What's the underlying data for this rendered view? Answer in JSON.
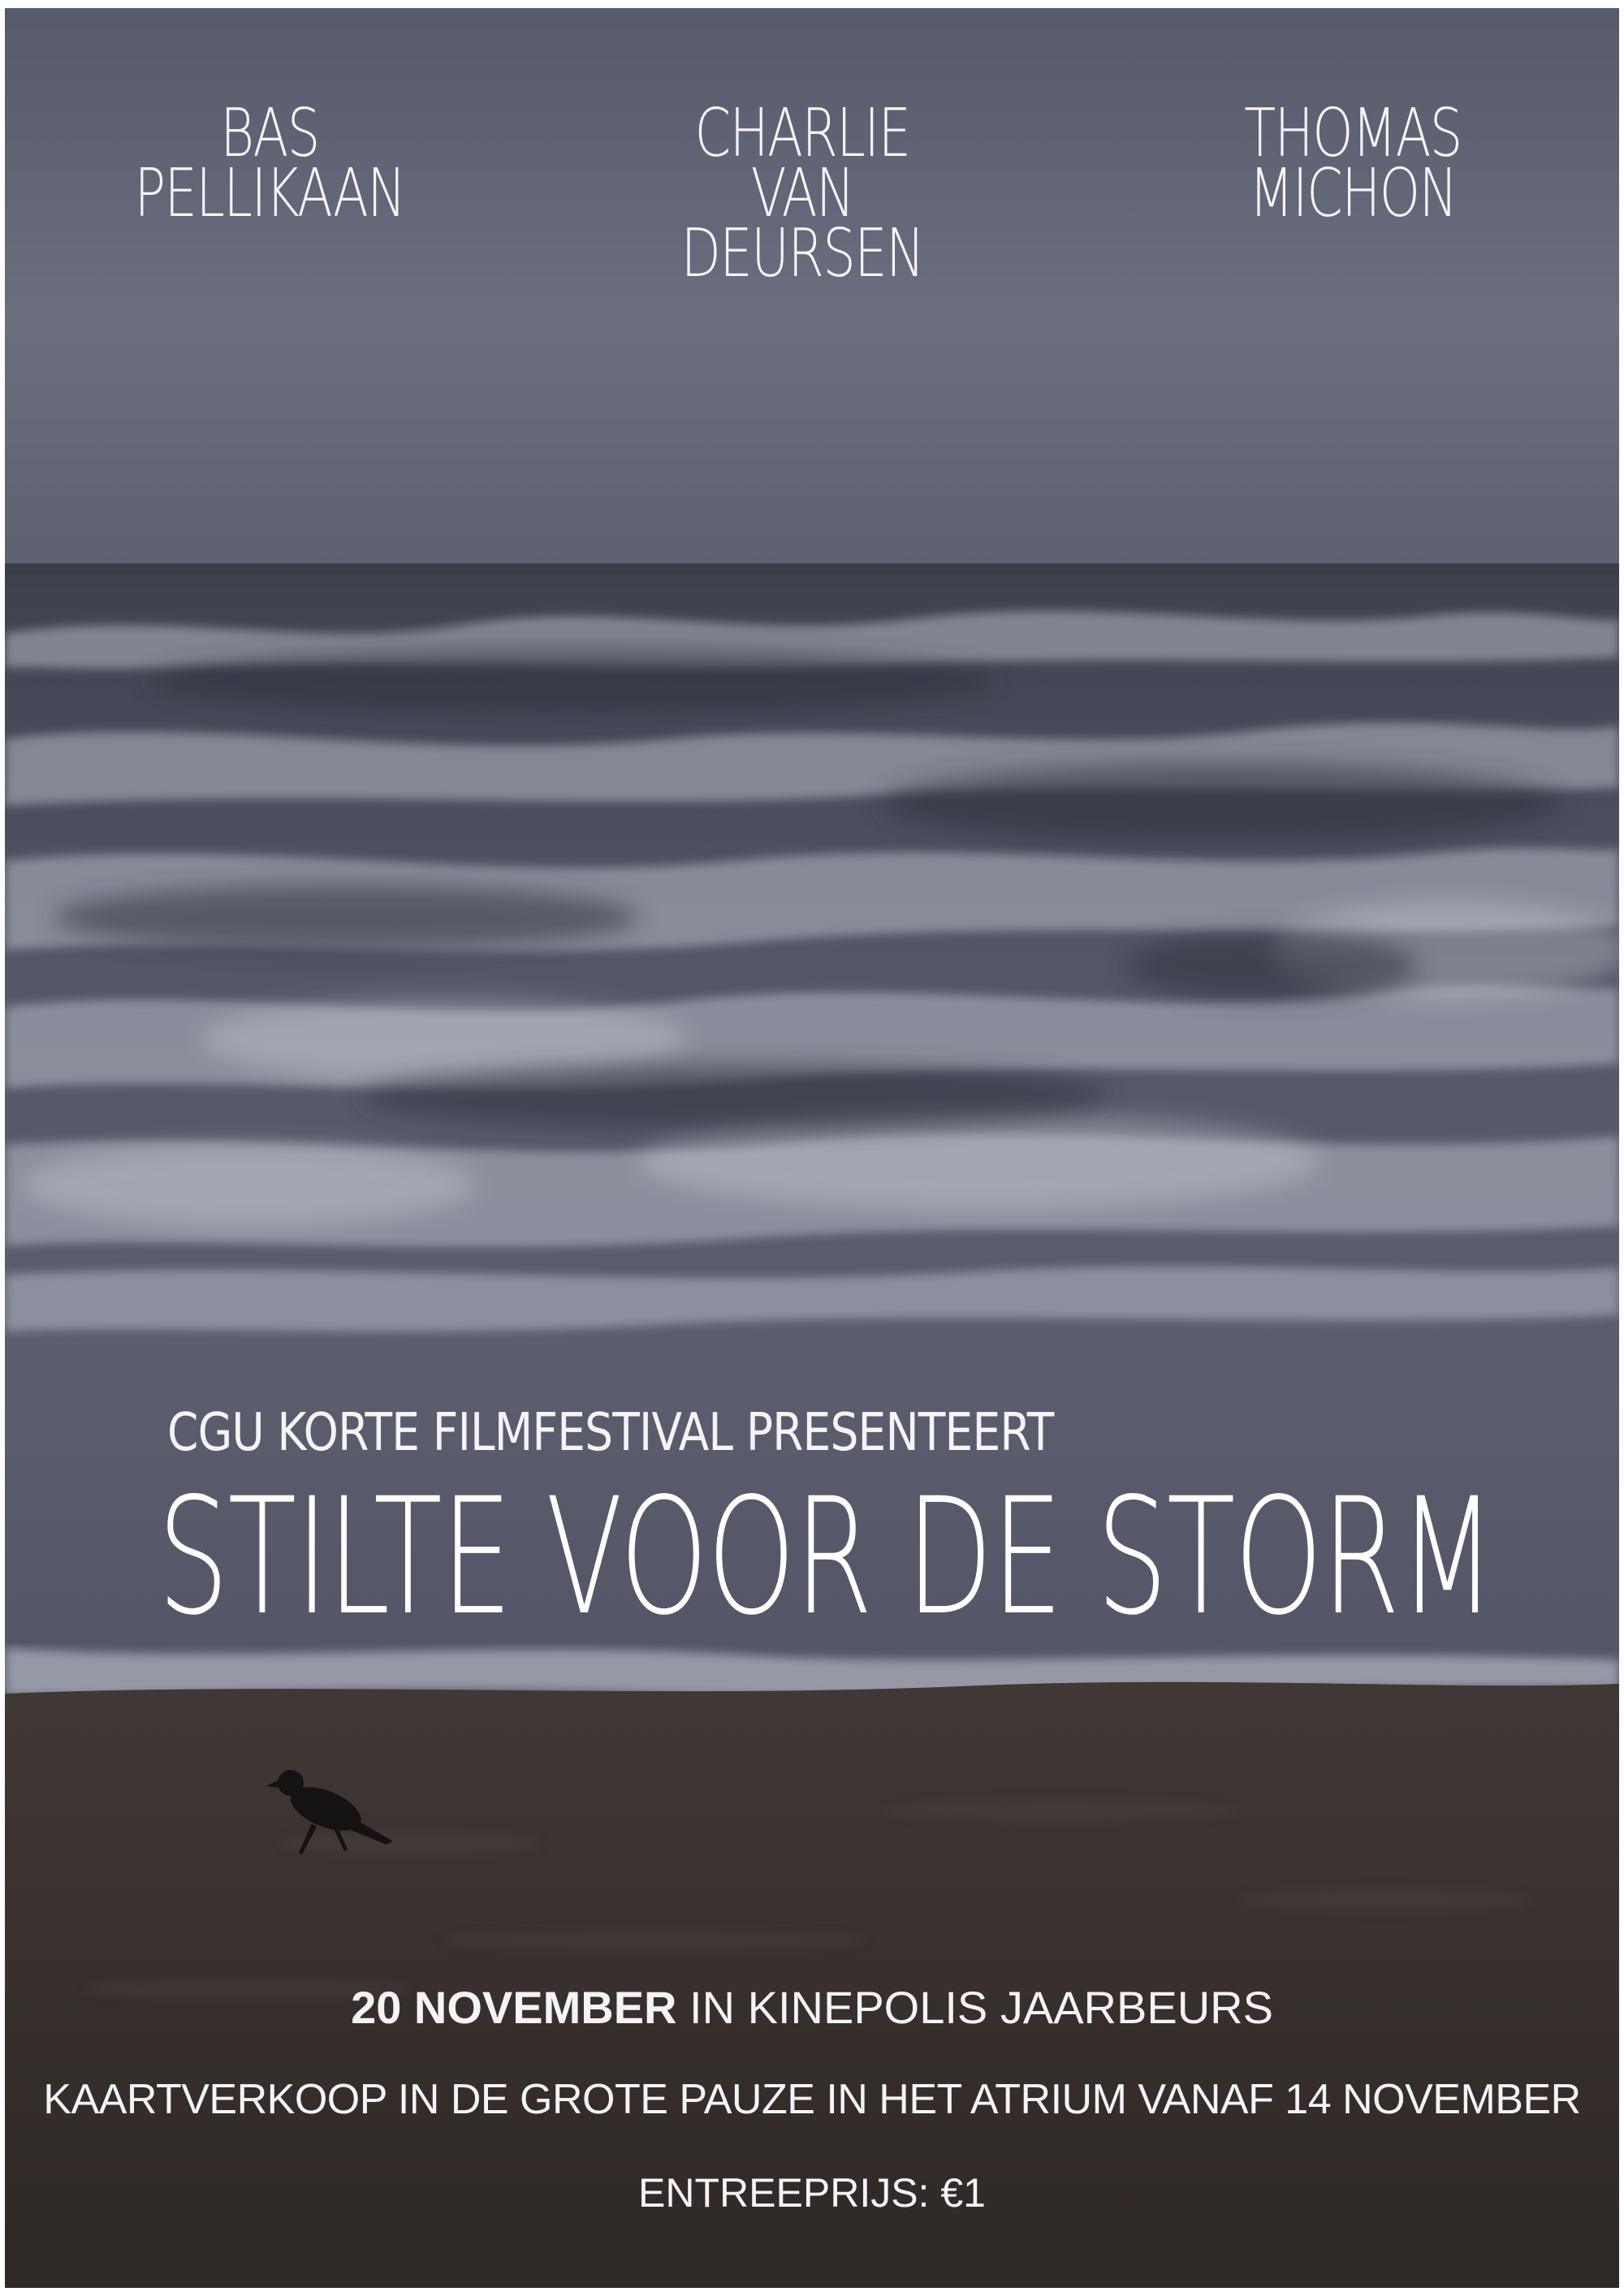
{
  "colors": {
    "sky": "#5d6170",
    "sea": "#4a4c5c",
    "foam": "#b9bbc8",
    "sand": "#3b3330",
    "text": "#f4f4f6"
  },
  "credits": [
    {
      "line1": "BAS",
      "line2": "PELLIKAAN"
    },
    {
      "line1": "CHARLIE",
      "line2": "VAN DEURSEN"
    },
    {
      "line1": "THOMAS",
      "line2": "MICHON"
    }
  ],
  "presenter": "CGU KORTE FILMFESTIVAL PRESENTEERT",
  "title": "STILTE VOOR DE STORM",
  "event": {
    "date": "20 NOVEMBER",
    "location": " IN KINEPOLIS JAARBEURS",
    "ticket_sales": "KAARTVERKOOP IN DE GROTE PAUZE IN HET ATRIUM VANAF 14 NOVEMBER",
    "price": "ENTREEPRIJS: €1"
  },
  "image": {
    "scene": "stormy sea with breaking waves over a dark beach",
    "bird": "crow-icon"
  }
}
